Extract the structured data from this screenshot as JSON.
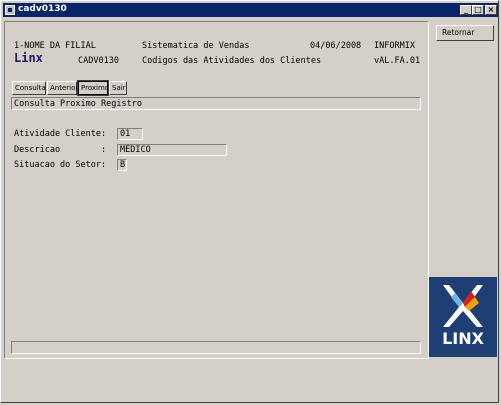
{
  "window": {
    "title": "cadv0130"
  },
  "titlebar_buttons": {
    "minimize": "_",
    "maximize": "□",
    "close": "×"
  },
  "header": {
    "company": "1-NOME DA FILIAL",
    "system": "Sistematica de Vendas",
    "date": "04/06/2008",
    "db": "INFORMIX",
    "app": "Linx",
    "program": "CADV0130",
    "screen_title": "Codigos das Atividades dos Clientes",
    "version": "vAL.FA.01"
  },
  "menu": {
    "items": [
      "Consulta",
      "Anterior",
      "Proximo",
      "Sair"
    ],
    "active": "Proximo"
  },
  "status": {
    "message": "Consulta Proximo Registro"
  },
  "form": {
    "atividade_label": "Atividade Cliente:",
    "atividade_value": "01",
    "descricao_label": "Descricao        :",
    "descricao_value": "MEDICO",
    "situacao_label": "Situacao do Setor:",
    "situacao_value": "B"
  },
  "side": {
    "retornar_label": "Retornar"
  },
  "logo": {
    "text": "LINX"
  }
}
